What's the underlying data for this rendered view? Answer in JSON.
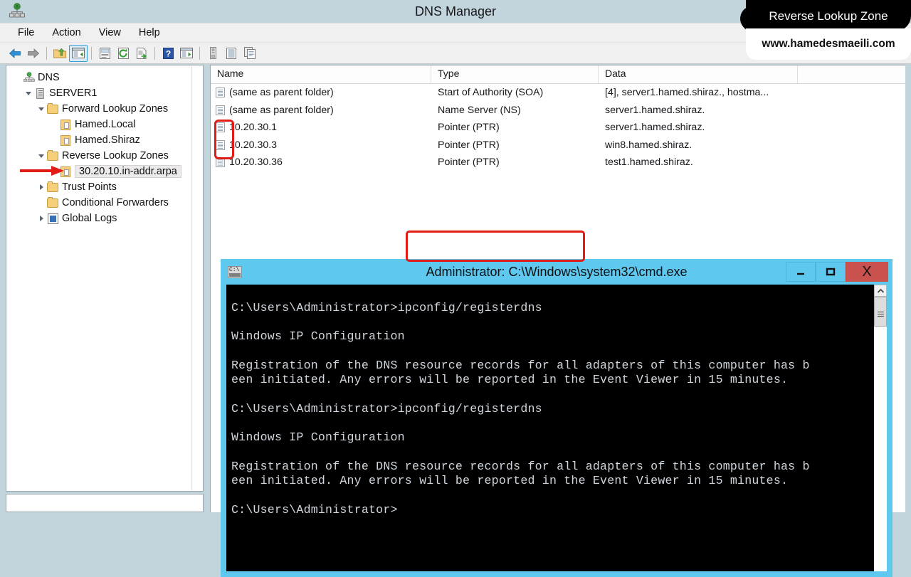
{
  "window": {
    "title": "DNS Manager",
    "app_icon": "dns-manager-icon"
  },
  "menu": {
    "items": [
      {
        "label": "File",
        "name": "menu-file"
      },
      {
        "label": "Action",
        "name": "menu-action"
      },
      {
        "label": "View",
        "name": "menu-view"
      },
      {
        "label": "Help",
        "name": "menu-help"
      }
    ]
  },
  "toolbar": {
    "buttons": [
      {
        "icon": "back-arrow-icon",
        "selected": false
      },
      {
        "icon": "forward-arrow-icon",
        "selected": false
      },
      {
        "icon": "up-folder-icon",
        "selected": false
      },
      {
        "icon": "show-hide-console-tree-icon",
        "selected": true
      },
      {
        "icon": "properties-icon",
        "selected": false
      },
      {
        "icon": "refresh-icon",
        "selected": false
      },
      {
        "icon": "export-list-icon",
        "selected": false
      },
      {
        "icon": "help-icon",
        "selected": false
      },
      {
        "icon": "show-hide-action-pane-icon",
        "selected": false
      },
      {
        "icon": "new-server-icon",
        "selected": false
      },
      {
        "icon": "new-zone-icon",
        "selected": false
      },
      {
        "icon": "copy-records-icon",
        "selected": false
      }
    ]
  },
  "tree": {
    "nodes": [
      {
        "label": "DNS",
        "indent": 0,
        "twisty": "none",
        "icon": "dns-root-icon",
        "selected": false
      },
      {
        "label": "SERVER1",
        "indent": 1,
        "twisty": "open",
        "icon": "server-icon",
        "selected": false
      },
      {
        "label": "Forward Lookup Zones",
        "indent": 2,
        "twisty": "open",
        "icon": "folder-icon",
        "selected": false
      },
      {
        "label": "Hamed.Local",
        "indent": 3,
        "twisty": "none",
        "icon": "zone-icon",
        "selected": false
      },
      {
        "label": "Hamed.Shiraz",
        "indent": 3,
        "twisty": "none",
        "icon": "zone-icon",
        "selected": false
      },
      {
        "label": "Reverse Lookup Zones",
        "indent": 2,
        "twisty": "open",
        "icon": "folder-icon",
        "selected": false
      },
      {
        "label": "30.20.10.in-addr.arpa",
        "indent": 3,
        "twisty": "none",
        "icon": "zone-icon",
        "selected": true
      },
      {
        "label": "Trust Points",
        "indent": 2,
        "twisty": "closed",
        "icon": "folder-icon",
        "selected": false
      },
      {
        "label": "Conditional Forwarders",
        "indent": 2,
        "twisty": "none",
        "icon": "folder-icon",
        "selected": false
      },
      {
        "label": "Global Logs",
        "indent": 2,
        "twisty": "closed",
        "icon": "global-logs-icon",
        "selected": false
      }
    ]
  },
  "list": {
    "columns": [
      {
        "label": "Name",
        "name": "column-header-name"
      },
      {
        "label": "Type",
        "name": "column-header-type"
      },
      {
        "label": "Data",
        "name": "column-header-data"
      },
      {
        "label": "",
        "name": "column-header-filler"
      }
    ],
    "rows": [
      {
        "name": "(same as parent folder)",
        "type": "Start of Authority (SOA)",
        "data": "[4], server1.hamed.shiraz., hostma...",
        "icon": "record-icon"
      },
      {
        "name": "(same as parent folder)",
        "type": "Name Server (NS)",
        "data": "server1.hamed.shiraz.",
        "icon": "record-icon"
      },
      {
        "name": "10.20.30.1",
        "type": "Pointer (PTR)",
        "data": "server1.hamed.shiraz.",
        "icon": "record-icon"
      },
      {
        "name": "10.20.30.3",
        "type": "Pointer (PTR)",
        "data": "win8.hamed.shiraz.",
        "icon": "record-icon"
      },
      {
        "name": "10.20.30.36",
        "type": "Pointer (PTR)",
        "data": "test1.hamed.shiraz.",
        "icon": "record-icon-dim"
      }
    ]
  },
  "cmd": {
    "title": "Administrator: C:\\Windows\\system32\\cmd.exe",
    "icon": "cmd-console-icon",
    "minimize_label": "–",
    "maximize_label": "□",
    "close_label": "X",
    "content": "C:\\Users\\Administrator>ipconfig/registerdns\n\nWindows IP Configuration\n\nRegistration of the DNS resource records for all adapters of this computer has b\neen initiated. Any errors will be reported in the Event Viewer in 15 minutes.\n\nC:\\Users\\Administrator>ipconfig/registerdns\n\nWindows IP Configuration\n\nRegistration of the DNS resource records for all adapters of this computer has b\neen initiated. Any errors will be reported in the Event Viewer in 15 minutes.\n\nC:\\Users\\Administrator>",
    "scrollbar": {
      "up_icon": "scroll-up-icon",
      "thumb": "scrollbar-thumb"
    }
  },
  "annotations": {
    "highlight_color": "#e11b16",
    "command_box_target": "ipconfig/registerdns",
    "ptr_rows_box_target": "10.20.30.1 / 10.20.30.3 record icons",
    "arrow_target": "30.20.10.in-addr.arpa"
  },
  "watermark": {
    "title": "Reverse Lookup Zone",
    "url": "www.hamedesmaeili.com"
  }
}
